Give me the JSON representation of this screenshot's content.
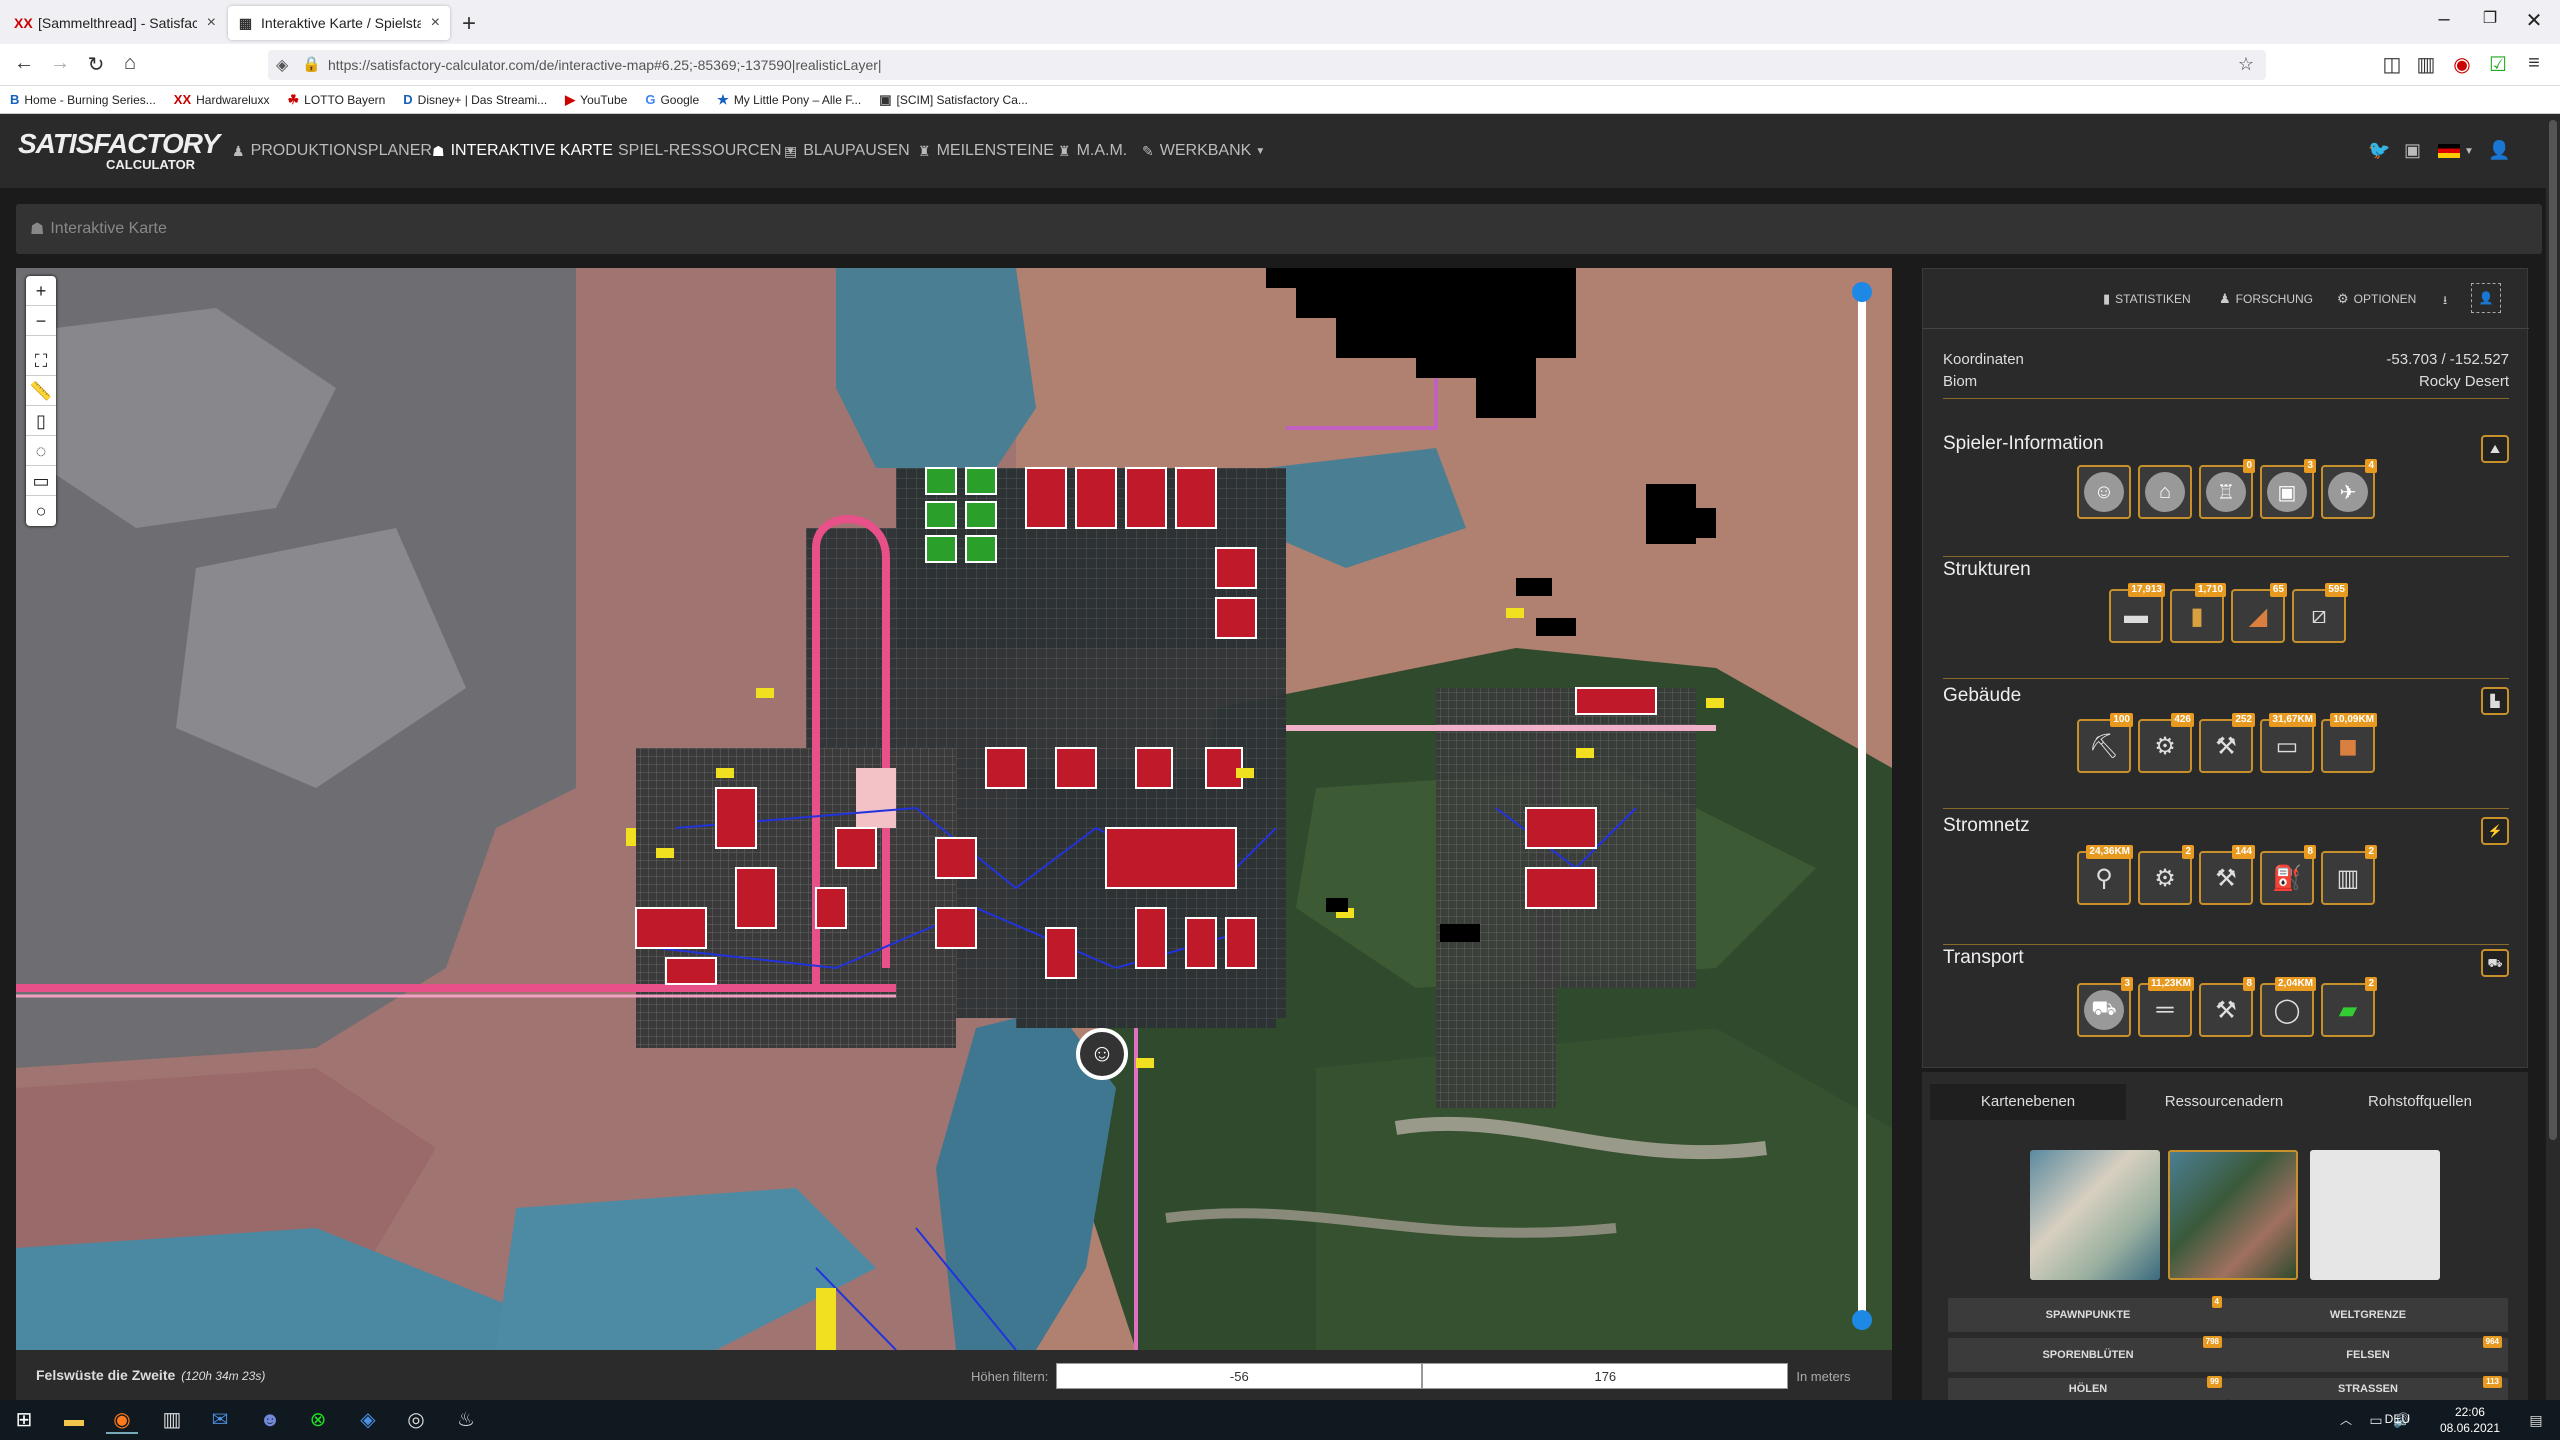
{
  "browser": {
    "tabs": [
      {
        "label": "[Sammelthread] - Satisfactory |",
        "favicon": "XX"
      },
      {
        "label": "Interaktive Karte / Spielstand Ed",
        "favicon": "▦"
      }
    ],
    "url": "https://satisfactory-calculator.com/de/interactive-map#6.25;-85369;-137590|realisticLayer|",
    "bookmarks": [
      {
        "label": "Home - Burning Series...",
        "icon": "B"
      },
      {
        "label": "Hardwareluxx",
        "icon": "XX"
      },
      {
        "label": "LOTTO Bayern",
        "icon": "☘"
      },
      {
        "label": "Disney+ | Das Streami...",
        "icon": "D"
      },
      {
        "label": "YouTube",
        "icon": "▶"
      },
      {
        "label": "Google",
        "icon": "G"
      },
      {
        "label": "My Little Pony – Alle F...",
        "icon": "★"
      },
      {
        "label": "[SCIM] Satisfactory Ca...",
        "icon": "▣"
      }
    ]
  },
  "app": {
    "logo_top": "SATISFACTORY",
    "logo_bottom": "CALCULATOR",
    "nav": [
      {
        "label": "PRODUKTIONSPLANER",
        "icon": "♟"
      },
      {
        "label": "INTERAKTIVE KARTE",
        "icon": "☗"
      },
      {
        "label": "SPIEL-RESSOURCEN",
        "icon": ""
      },
      {
        "label": "BLAUPAUSEN",
        "icon": "▤"
      },
      {
        "label": "MEILENSTEINE",
        "icon": "♜"
      },
      {
        "label": "M.A.M.",
        "icon": "♜"
      },
      {
        "label": "WERKBANK",
        "icon": "✎"
      }
    ],
    "breadcrumb": "Interaktive Karte"
  },
  "map": {
    "save_name": "Felswüste die Zweite",
    "playtime": "(120h 34m 23s)",
    "height_filter_label": "Höhen filtern:",
    "height_min": "-56",
    "height_max": "176",
    "height_unit": "In meters"
  },
  "panel": {
    "tabs": [
      {
        "label": "STATISTIKEN",
        "icon": "▮"
      },
      {
        "label": "FORSCHUNG",
        "icon": "♟"
      },
      {
        "label": "OPTIONEN",
        "icon": "⚙"
      }
    ],
    "coord_label": "Koordinaten",
    "coord_value": "-53.703 / -152.527",
    "biome_label": "Biom",
    "biome_value": "Rocky Desert",
    "sections": {
      "player": {
        "title": "Spieler-Information",
        "badges": [
          "",
          "",
          "0",
          "3",
          "4"
        ]
      },
      "structures": {
        "title": "Strukturen",
        "badges": [
          "17,913",
          "1,710",
          "65",
          "595"
        ]
      },
      "buildings": {
        "title": "Gebäude",
        "badges": [
          "100",
          "426",
          "252",
          "31,67KM",
          "10,09KM"
        ]
      },
      "power": {
        "title": "Stromnetz",
        "badges": [
          "24,36KM",
          "2",
          "144",
          "8",
          "2"
        ]
      },
      "transport": {
        "title": "Transport",
        "badges": [
          "3",
          "11,23KM",
          "8",
          "2,04KM",
          "2"
        ]
      }
    }
  },
  "layers": {
    "tabs": [
      "Kartenebenen",
      "Ressourcenadern",
      "Rohstoffquellen"
    ],
    "buttons": [
      {
        "label": "SPAWNPUNKTE",
        "badge": "4"
      },
      {
        "label": "WELTGRENZE",
        "badge": ""
      },
      {
        "label": "SPORENBLÜTEN",
        "badge": "798"
      },
      {
        "label": "FELSEN",
        "badge": "964"
      },
      {
        "label": "HÖLEN",
        "badge": "99"
      },
      {
        "label": "STRASSEN",
        "badge": "113"
      }
    ]
  },
  "taskbar": {
    "lang": "DEU",
    "time": "22:06",
    "date": "08.06.2021"
  }
}
